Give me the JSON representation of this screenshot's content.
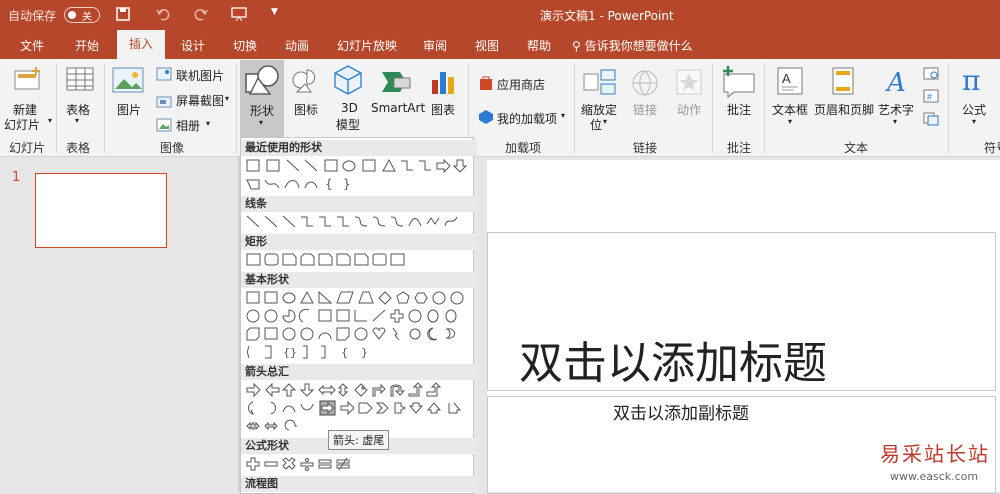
{
  "titlebar": {
    "autosave": "自动保存",
    "autosave_state": "关",
    "title": "演示文稿1  -  PowerPoint"
  },
  "tabs": [
    "文件",
    "开始",
    "插入",
    "设计",
    "切换",
    "动画",
    "幻灯片放映",
    "审阅",
    "视图",
    "帮助"
  ],
  "tellme": "告诉我你想要做什么",
  "ribbon": {
    "new_slide": [
      "新建",
      "幻灯片"
    ],
    "table": "表格",
    "picture": "图片",
    "online_picture": "联机图片",
    "screenshot": "屏幕截图",
    "album": "相册",
    "shapes": "形状",
    "icons": "图标",
    "model3d": [
      "3D",
      "模型"
    ],
    "smartart": "SmartArt",
    "chart": "图表",
    "store": "应用商店",
    "my_addins": "我的加载项",
    "zoom": [
      "缩放定",
      "位"
    ],
    "link": "链接",
    "action": "动作",
    "comment": "批注",
    "textbox": "文本框",
    "header_footer": "页眉和页脚",
    "wordart": "艺术字",
    "equation": "公式",
    "groups": {
      "slides": "幻灯片",
      "tables": "表格",
      "images": "图像",
      "addins": "加载项",
      "links": "链接",
      "comments": "批注",
      "text": "文本",
      "symbols": "符号"
    }
  },
  "gallery": {
    "recent": "最近使用的形状",
    "lines": "线条",
    "rect": "矩形",
    "basic": "基本形状",
    "arrows": "箭头总汇",
    "equation": "公式形状",
    "flowchart": "流程图",
    "tooltip": "箭头: 虚尾"
  },
  "slide_number": "1",
  "slide": {
    "title": "双击以添加标题",
    "subtitle": "双击以添加副标题"
  },
  "watermark": {
    "name": "易采站长站",
    "url": "www.easck.com"
  }
}
